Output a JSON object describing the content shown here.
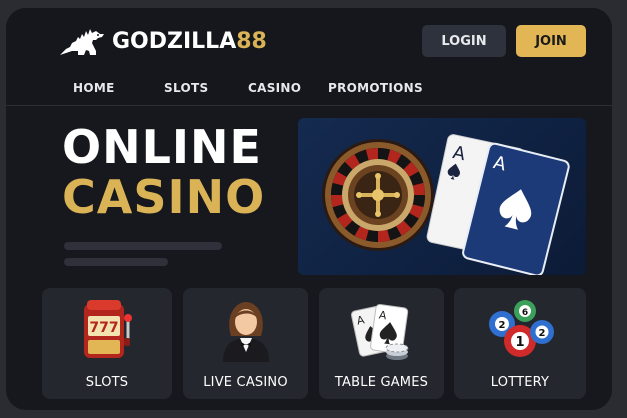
{
  "brand": {
    "name_white": "GODZILLA",
    "name_gold": "88",
    "accent": "#d9b355"
  },
  "header": {
    "login_label": "LOGIN",
    "join_label": "JOIN"
  },
  "nav": {
    "items": [
      "HOME",
      "SLOTS",
      "CASINO",
      "PROMOTIONS"
    ]
  },
  "hero": {
    "line1": "ONLINE",
    "line2": "CASINO",
    "image_icons": [
      "roulette-wheel-icon",
      "ace-of-spades-card-icon"
    ]
  },
  "categories": [
    {
      "label": "SLOTS",
      "icon": "slot-machine-icon"
    },
    {
      "label": "LIVE CASINO",
      "icon": "dealer-icon"
    },
    {
      "label": "TABLE GAMES",
      "icon": "playing-cards-chips-icon"
    },
    {
      "label": "LOTTERY",
      "icon": "lottery-balls-icon"
    }
  ],
  "lottery_balls": [
    "2",
    "6",
    "1",
    "2"
  ],
  "card_ranks": [
    "A",
    "A"
  ],
  "slot_reels": "777"
}
